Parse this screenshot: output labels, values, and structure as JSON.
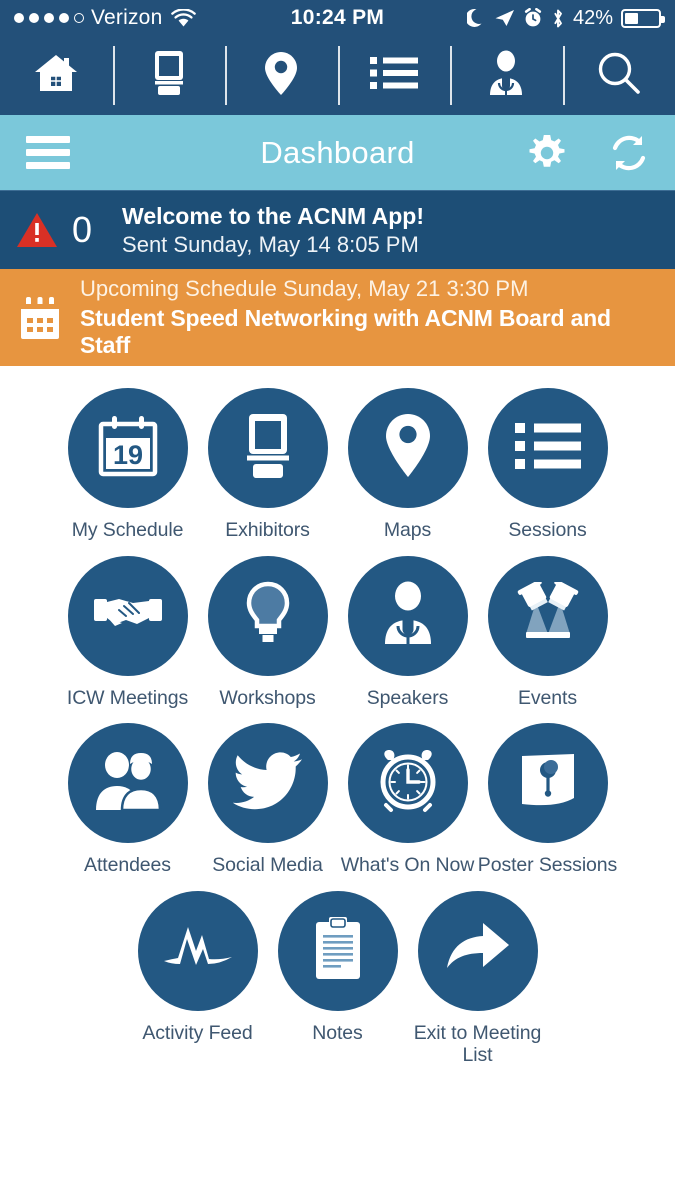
{
  "status_bar": {
    "carrier": "Verizon",
    "signal_dots_filled": 4,
    "signal_dots_total": 5,
    "wifi_icon": "wifi-icon",
    "time": "10:24 PM",
    "indicators": [
      "moon-icon",
      "location-arrow-icon",
      "alarm-clock-icon",
      "bluetooth-icon"
    ],
    "battery_percent": "42%",
    "battery_level": 42
  },
  "toolbar": {
    "items": [
      {
        "name": "home-icon",
        "label": "Home"
      },
      {
        "name": "exhibitors-icon",
        "label": "Exhibitors"
      },
      {
        "name": "map-pin-icon",
        "label": "Maps"
      },
      {
        "name": "list-icon",
        "label": "Sessions"
      },
      {
        "name": "speaker-icon",
        "label": "Speakers"
      },
      {
        "name": "search-icon",
        "label": "Search"
      }
    ]
  },
  "header": {
    "menu_icon": "hamburger-menu-icon",
    "title": "Dashboard",
    "settings_icon": "gear-icon",
    "refresh_icon": "refresh-icon"
  },
  "alert": {
    "icon": "warning-triangle-icon",
    "count": "0",
    "title": "Welcome to the ACNM App!",
    "subtitle": "Sent Sunday, May 14 8:05 PM"
  },
  "schedule": {
    "icon": "calendar-icon",
    "upcoming_line": "Upcoming Schedule Sunday, May 21 3:30 PM",
    "event_title": "Student Speed Networking with ACNM Board and Staff"
  },
  "grid": {
    "rows": [
      [
        {
          "label": "My Schedule",
          "icon": "calendar-19-icon"
        },
        {
          "label": "Exhibitors",
          "icon": "exhibitor-booth-icon"
        },
        {
          "label": "Maps",
          "icon": "map-pin-icon"
        },
        {
          "label": "Sessions",
          "icon": "list-icon"
        }
      ],
      [
        {
          "label": "ICW Meetings",
          "icon": "handshake-icon"
        },
        {
          "label": "Workshops",
          "icon": "lightbulb-icon"
        },
        {
          "label": "Speakers",
          "icon": "speaker-microphone-icon"
        },
        {
          "label": "Events",
          "icon": "spotlights-icon"
        }
      ],
      [
        {
          "label": "Attendees",
          "icon": "people-icon"
        },
        {
          "label": "Social Media",
          "icon": "twitter-bird-icon"
        },
        {
          "label": "What's On Now",
          "icon": "alarm-clock-icon"
        },
        {
          "label": "Poster Sessions",
          "icon": "poster-pin-icon"
        }
      ],
      [
        {
          "label": "Activity Feed",
          "icon": "pulse-wave-icon"
        },
        {
          "label": "Notes",
          "icon": "clipboard-icon"
        },
        {
          "label": "Exit to Meeting List",
          "icon": "forward-arrow-icon"
        }
      ]
    ]
  },
  "colors": {
    "dark_blue": "#235079",
    "tile_blue": "#235883",
    "header_light_blue": "#7bc8da",
    "alert_blue": "#1d4e76",
    "orange": "#e79540",
    "warning_red": "#d93025",
    "label_text": "#3f5770"
  }
}
